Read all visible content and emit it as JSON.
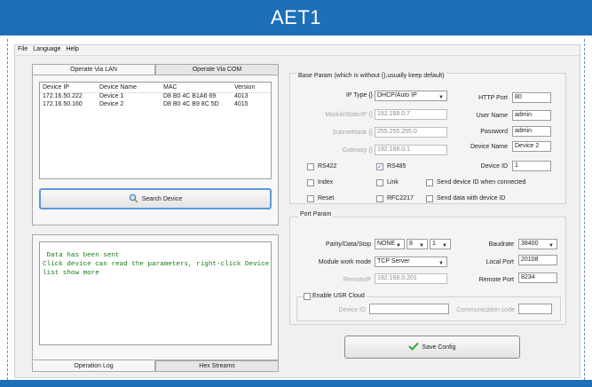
{
  "banner": {
    "title": "AET1"
  },
  "menu": [
    "File",
    "Language",
    "Help"
  ],
  "left_tabs": {
    "lan": "Operate Via LAN",
    "com": "Operate Via COM"
  },
  "device_table": {
    "headers": [
      "Device IP",
      "Device Name",
      "MAC",
      "Version"
    ],
    "rows": [
      [
        "172.16.50.222",
        "Device 1",
        "D8 B0 4C B1A6 69",
        "4013"
      ],
      [
        "172.16.50.160",
        "Device 2",
        "D8 B0 4C B9 8C 5D",
        "4015"
      ]
    ]
  },
  "search_button": "Search Device",
  "log": {
    "lines": [
      " Data has been sent",
      "Click device can read the parameters, right-click Device",
      "list show more"
    ]
  },
  "bottom_tabs": {
    "log": "Operation Log",
    "hex": "Hex Streams"
  },
  "base": {
    "title": "Base Param (which is without {},usually keep default)",
    "ip_type_label": "IP Type {}",
    "ip_type_value": "DHCP/Auto IP",
    "module_ip_label": "ModuleStaticIP {}",
    "module_ip_value": "192.168.0.7",
    "submask_label": "SubnetMask {}",
    "submask_value": "255.255.255.0",
    "gateway_label": "Gateway {}",
    "gateway_value": "192.168.0.1",
    "http_port_label": "HTTP Port",
    "http_port_value": "80",
    "user_name_label": "User Name",
    "user_name_value": "admin",
    "password_label": "Password",
    "password_value": "admin",
    "device_name_label": "Device Name",
    "device_name_value": "Device 2",
    "device_id_label": "Device ID",
    "device_id_value": "1",
    "rs422": "RS422",
    "rs485": "RS485",
    "send_id_connected": "Send device ID when connected",
    "index": "Index",
    "link": "Link",
    "reset": "Reset",
    "rfc2217": "RFC2217",
    "send_data_id": "Send data with device ID",
    "rs485_checked": "✓"
  },
  "port": {
    "title": "Port Param",
    "parity_label": "Parity/Data/Stop",
    "parity_value": "NONE",
    "data_value": "8",
    "stop_value": "1",
    "baud_label": "Baudrate",
    "baud_value": "38400",
    "work_mode_label": "Module work mode",
    "work_mode_value": "TCP Server",
    "local_port_label": "Local Port",
    "local_port_value": "20108",
    "remote_ip_label": "RemoteIP",
    "remote_ip_value": "192.168.0.201",
    "remote_port_label": "Remote Port",
    "remote_port_value": "8234"
  },
  "cloud": {
    "enable_label": "Enable USR Cloud",
    "device_id_label": "Device ID",
    "comm_code_label": "Communication code"
  },
  "save_button": "Save Config"
}
